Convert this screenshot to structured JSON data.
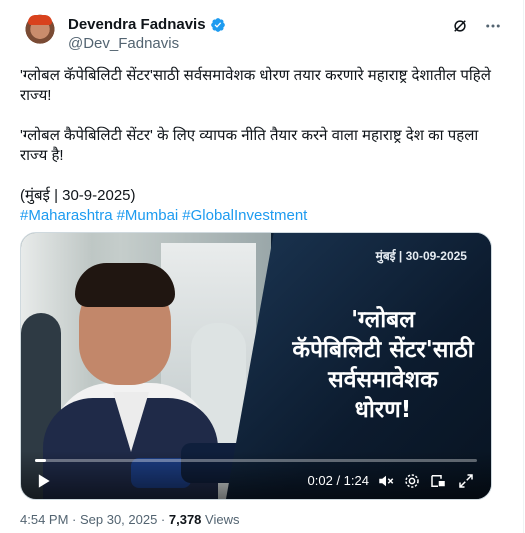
{
  "author": {
    "name": "Devendra Fadnavis",
    "handle": "@Dev_Fadnavis"
  },
  "tweet": {
    "line_mr": "'ग्लोबल कॅपेबिलिटी सेंटर'साठी सर्वसमावेशक धोरण तयार करणारे महाराष्ट्र देशातील पहिले राज्य!",
    "line_hi": "'ग्लोबल कैपेबिलिटी सेंटर' के लिए व्यापक नीति तैयार करने वाला महाराष्ट्र देश का पहला राज्य है!",
    "dateline": "(मुंबई | 30-9-2025)",
    "hashtags": [
      "#Maharashtra",
      "#Mumbai",
      "#GlobalInvestment"
    ]
  },
  "video": {
    "date_overlay": "मुंबई | 30-09-2025",
    "title_line1": "'ग्लोबल",
    "title_line2": "कॅपेबिलिटी सेंटर'साठी",
    "title_line3": "सर्वसमावेशक",
    "title_line4": "धोरण!",
    "time": "0:02 / 1:24",
    "progress": 0.024
  },
  "meta": {
    "time": "4:54 PM · Sep 30, 2025 · ",
    "views_count": "7,378",
    "views_label": " Views"
  },
  "colors": {
    "link": "#1d9bf0",
    "verified": "#1d9bf0",
    "muted": "#536471"
  }
}
